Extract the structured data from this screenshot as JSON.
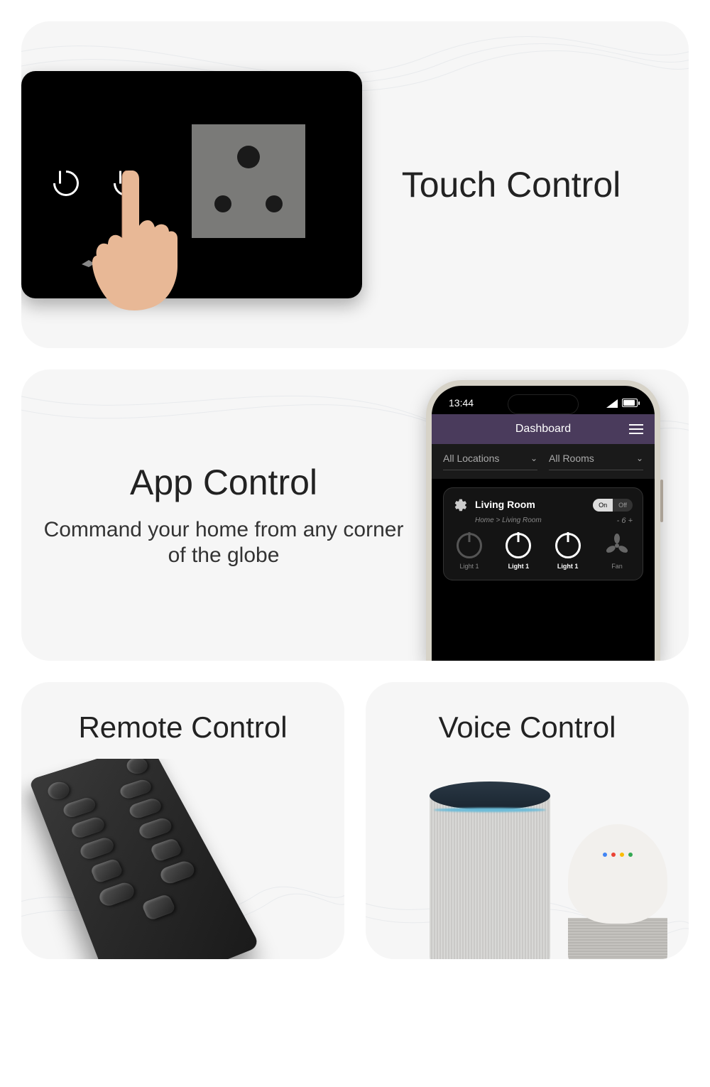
{
  "card1": {
    "title": "Touch Control"
  },
  "card2": {
    "title": "App Control",
    "subtitle": "Command your home from any corner of the globe"
  },
  "phone": {
    "time": "13:44",
    "header": "Dashboard",
    "filter1": "All Locations",
    "filter2": "All Rooms",
    "room_name": "Living Room",
    "breadcrumb": "Home > Living Room",
    "toggle_on": "On",
    "toggle_off": "Off",
    "fan_level": "6",
    "devices": {
      "d1": "Light 1",
      "d2": "Light 1",
      "d3": "Light 1",
      "d4": "Fan"
    }
  },
  "card3": {
    "title": "Remote Control"
  },
  "card4": {
    "title": "Voice Control"
  }
}
